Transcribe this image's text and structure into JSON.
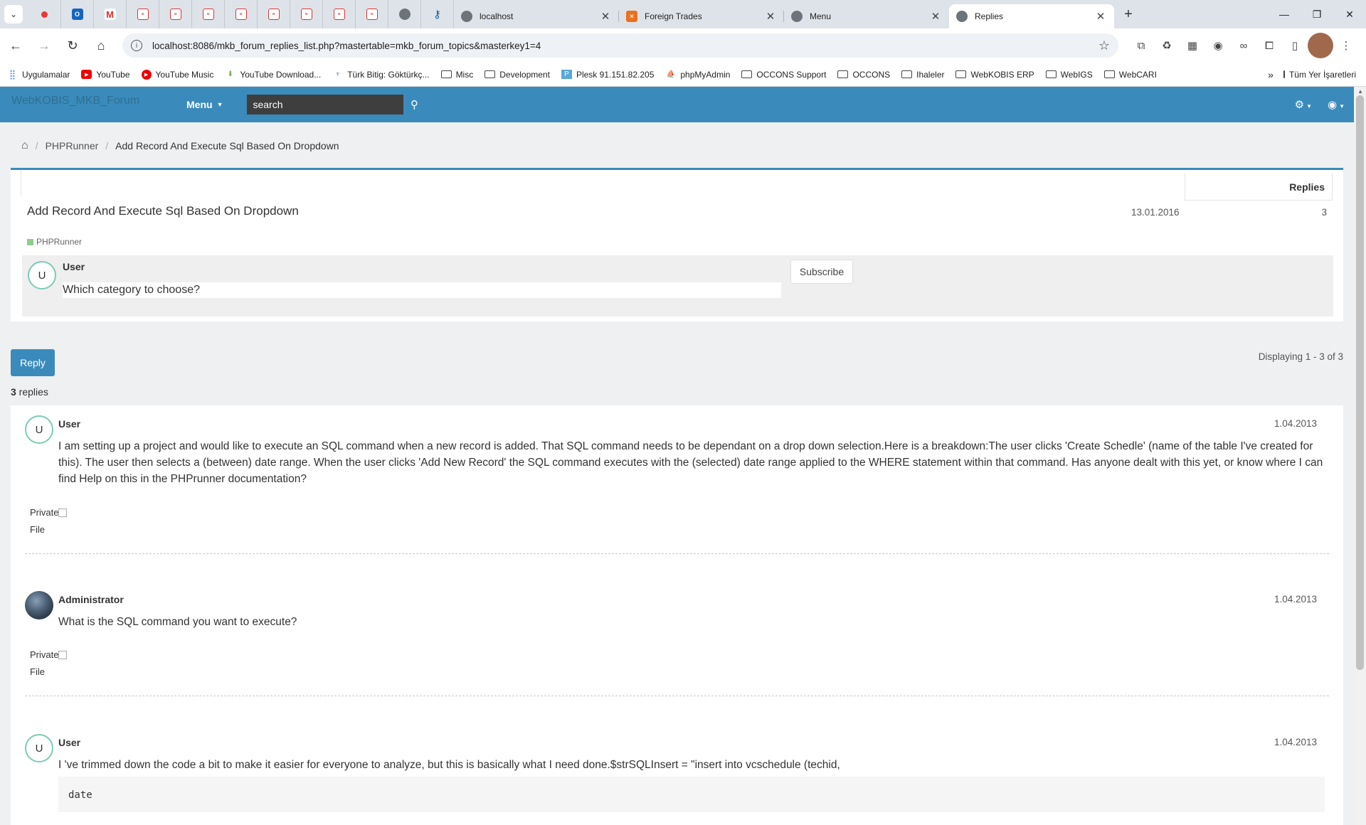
{
  "browser": {
    "tabs": [
      {
        "title": "localhost",
        "close": "✕"
      },
      {
        "title": "Foreign Trades",
        "close": "✕"
      },
      {
        "title": "Menu",
        "close": "✕"
      },
      {
        "title": "Replies",
        "close": "✕"
      }
    ],
    "new_tab": "+",
    "url": "localhost:8086/mkb_forum_replies_list.php?mastertable=mkb_forum_topics&masterkey1=4",
    "bookmarks": [
      {
        "label": "Uygulamalar",
        "icon": "apps-icon"
      },
      {
        "label": "YouTube",
        "icon": "youtube-icon"
      },
      {
        "label": "YouTube Music",
        "icon": "youtube-music-icon"
      },
      {
        "label": "YouTube Download...",
        "icon": "download-icon"
      },
      {
        "label": "Türk Bitig: Göktürkç...",
        "icon": "turkbitig-icon"
      },
      {
        "label": "Misc",
        "icon": "folder-icon"
      },
      {
        "label": "Development",
        "icon": "folder-icon"
      },
      {
        "label": "Plesk 91.151.82.205",
        "icon": "plesk-icon"
      },
      {
        "label": "phpMyAdmin",
        "icon": "phpmyadmin-icon"
      },
      {
        "label": "OCCONS Support",
        "icon": "folder-icon"
      },
      {
        "label": "OCCONS",
        "icon": "folder-icon"
      },
      {
        "label": "Ihaleler",
        "icon": "folder-icon"
      },
      {
        "label": "WebKOBIS ERP",
        "icon": "folder-icon"
      },
      {
        "label": "WebIGS",
        "icon": "folder-icon"
      },
      {
        "label": "WebCARI",
        "icon": "folder-icon"
      }
    ],
    "bookmarks_more": "»",
    "all_bookmarks": "Tüm Yer İşaretleri"
  },
  "app": {
    "brand": "WebKOBIS_MKB_Forum",
    "menu_label": "Menu",
    "search_placeholder": "search"
  },
  "breadcrumb": {
    "category": "PHPRunner",
    "topic": "Add Record And Execute Sql Based On Dropdown"
  },
  "topic": {
    "replies_header": "Replies",
    "title": "Add Record And Execute Sql Based On Dropdown",
    "date": "13.01.2016",
    "replies_count": "3",
    "category": "PHPRunner",
    "poster_initial": "U",
    "poster": "User",
    "question": "Which category to choose?",
    "subscribe_label": "Subscribe"
  },
  "list": {
    "reply_label": "Reply",
    "displaying": "Displaying 1 - 3 of 3",
    "count_number": "3",
    "count_suffix": " replies"
  },
  "replies": [
    {
      "initial": "U",
      "poster": "User",
      "date": "1.04.2013",
      "body": "I am setting up a project and would like to execute an SQL command when a new record is added. That SQL command needs to be dependant on a drop down selection.Here is a breakdown:The user clicks 'Create Schedle' (name of the table I've created for this). The user then selects a (between) date range. When the user clicks 'Add New Record' the SQL command executes with the (selected) date range applied to the WHERE statement within that command. Has anyone dealt with this yet, or know where I can find Help on this in the PHPrunner documentation?",
      "private_label": "Private",
      "file_label": "File"
    },
    {
      "poster": "Administrator",
      "date": "1.04.2013",
      "body": "What is the SQL command you want to execute?",
      "private_label": "Private",
      "file_label": "File"
    },
    {
      "initial": "U",
      "poster": "User",
      "date": "1.04.2013",
      "body": "I 've trimmed down the code a bit to make it easier for everyone to analyze, but this is basically what I need done.$strSQLInsert = \"insert into vcschedule (techid,",
      "code": "date"
    }
  ],
  "colors": {
    "navbar": "#3a8bbb",
    "avatar_ring": "#7dcbb6",
    "category_marker": "#8bcf8b"
  }
}
